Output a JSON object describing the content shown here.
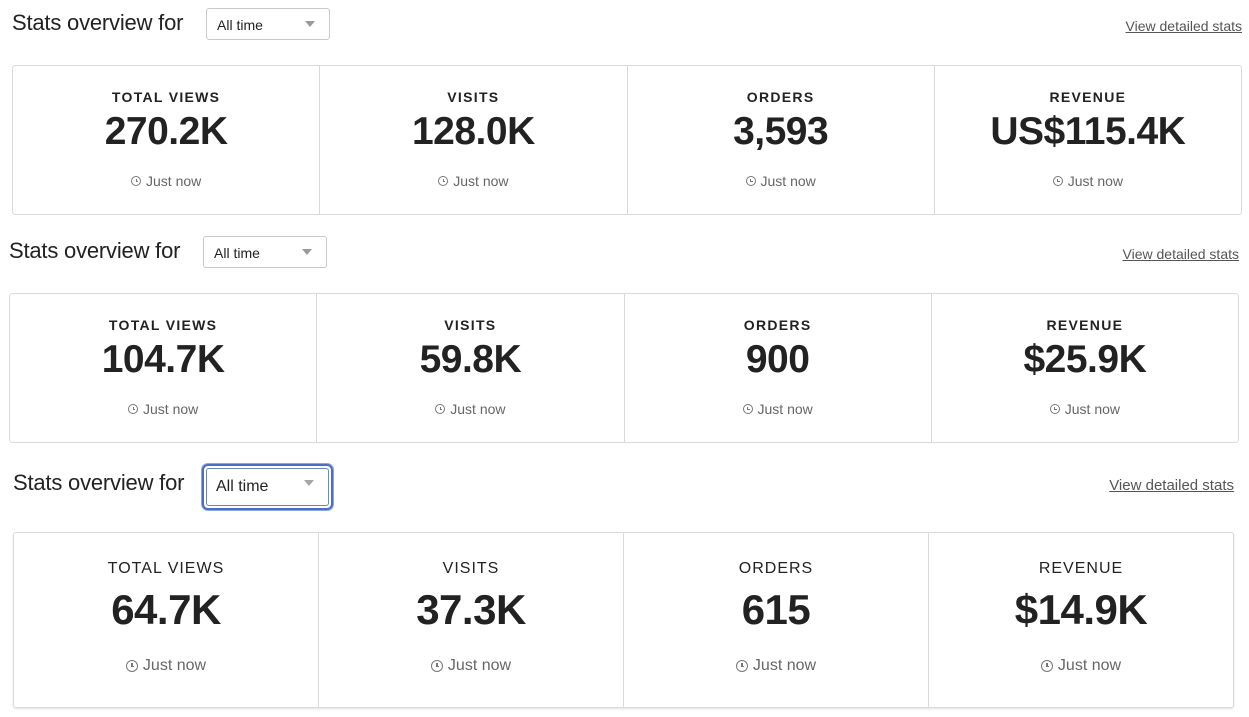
{
  "sections": [
    {
      "title": "Stats overview for",
      "period": "All time",
      "link": "View detailed stats",
      "stats": [
        {
          "label": "TOTAL VIEWS",
          "value": "270.2K",
          "time": "Just now"
        },
        {
          "label": "VISITS",
          "value": "128.0K",
          "time": "Just now"
        },
        {
          "label": "ORDERS",
          "value": "3,593",
          "time": "Just now"
        },
        {
          "label": "REVENUE",
          "value": "US$115.4K",
          "time": "Just now"
        }
      ]
    },
    {
      "title": "Stats overview for",
      "period": "All time",
      "link": "View detailed stats",
      "stats": [
        {
          "label": "TOTAL VIEWS",
          "value": "104.7K",
          "time": "Just now"
        },
        {
          "label": "VISITS",
          "value": "59.8K",
          "time": "Just now"
        },
        {
          "label": "ORDERS",
          "value": "900",
          "time": "Just now"
        },
        {
          "label": "REVENUE",
          "value": "$25.9K",
          "time": "Just now"
        }
      ]
    },
    {
      "title": "Stats overview for",
      "period": "All time",
      "link": "View detailed stats",
      "stats": [
        {
          "label": "TOTAL VIEWS",
          "value": "64.7K",
          "time": "Just now"
        },
        {
          "label": "VISITS",
          "value": "37.3K",
          "time": "Just now"
        },
        {
          "label": "ORDERS",
          "value": "615",
          "time": "Just now"
        },
        {
          "label": "REVENUE",
          "value": "$14.9K",
          "time": "Just now"
        }
      ]
    }
  ],
  "icons": {
    "time": "clock-icon",
    "select": "chevron-down-icon"
  },
  "colors": {
    "focus_ring": "#4a6fc9",
    "border": "#d9d9d9",
    "text": "#222222"
  }
}
